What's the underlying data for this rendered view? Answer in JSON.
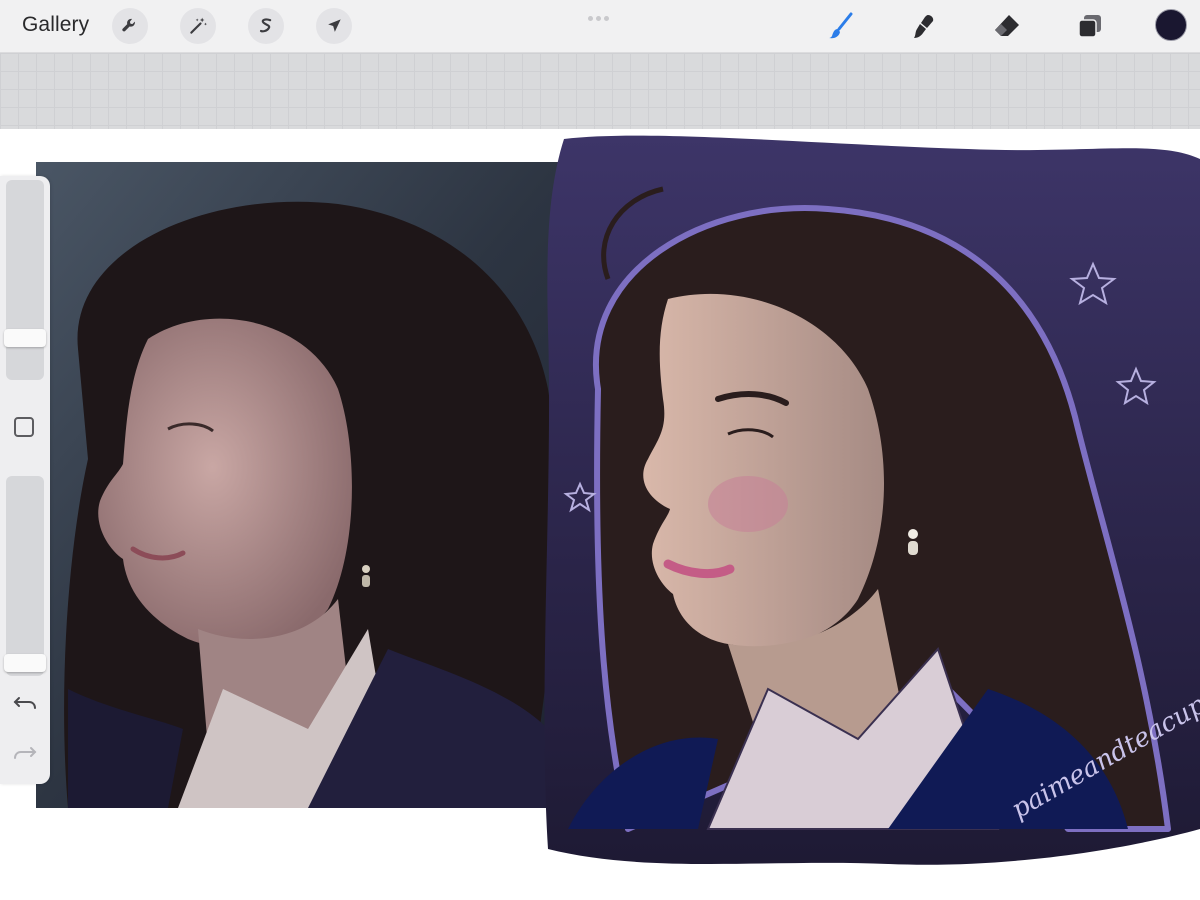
{
  "toolbar": {
    "gallery_label": "Gallery",
    "left_tools": [
      {
        "name": "actions",
        "icon": "wrench-icon"
      },
      {
        "name": "adjustments",
        "icon": "magic-wand-icon"
      },
      {
        "name": "selection",
        "icon": "selection-s-icon"
      },
      {
        "name": "transform",
        "icon": "arrow-cursor-icon"
      }
    ],
    "right_tools": [
      {
        "name": "brush",
        "icon": "brush-icon",
        "active": true
      },
      {
        "name": "smudge",
        "icon": "smudge-icon"
      },
      {
        "name": "eraser",
        "icon": "eraser-icon"
      },
      {
        "name": "layers",
        "icon": "layers-icon"
      }
    ],
    "active_color": "#1a1730",
    "accent_color": "#2b7de9"
  },
  "sidebar": {
    "brush_size_level": 0.18,
    "opacity_level": 0.02,
    "modify_icon": "square-icon",
    "undo_icon": "undo-icon",
    "redo_icon": "redo-icon"
  },
  "artwork": {
    "reference_photo": "photo-portrait-woman-profile",
    "digital_painting": "painted-portrait-woman-profile",
    "signature_text": "paimeandteacups",
    "background_color": "#5a4f8f"
  }
}
